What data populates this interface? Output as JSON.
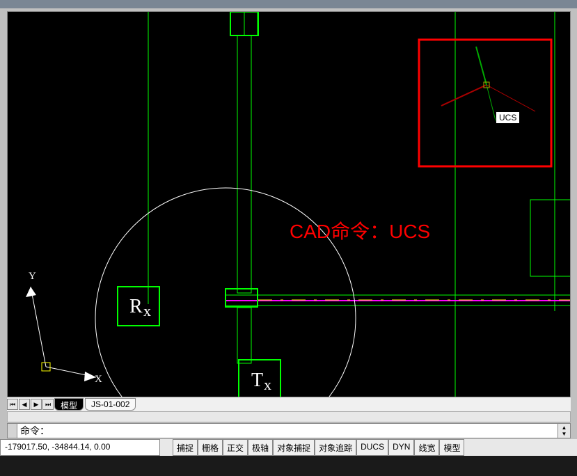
{
  "canvas": {
    "annotation_text": "CAD命令：UCS",
    "ucs_tooltip": "UCS",
    "drawing_labels": {
      "rx": "Rx",
      "tx": "Tx"
    },
    "ucs_axis_x": "X",
    "ucs_axis_y": "Y"
  },
  "tabs": {
    "model": "模型",
    "layout1": "JS-01-002"
  },
  "command": {
    "prompt": "命令："
  },
  "status": {
    "coords": "-179017.50, -34844.14, 0.00",
    "buttons": [
      "捕捉",
      "栅格",
      "正交",
      "极轴",
      "对象捕捉",
      "对象追踪",
      "DUCS",
      "DYN",
      "线宽",
      "模型"
    ]
  }
}
